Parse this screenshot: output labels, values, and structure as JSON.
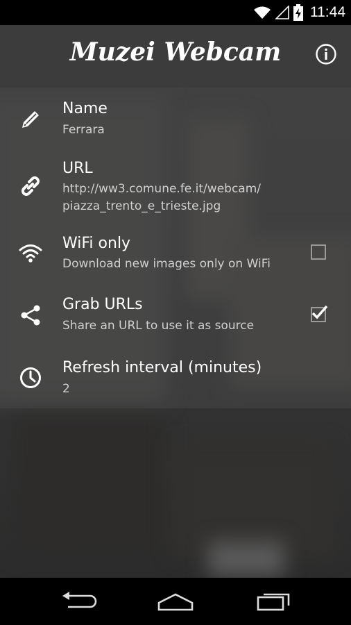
{
  "status_bar": {
    "time": "11:44",
    "icons": [
      "wifi-icon",
      "cell-signal-icon",
      "battery-charging-icon"
    ]
  },
  "app_bar": {
    "title": "Muzei Webcam",
    "info_icon": "info-icon"
  },
  "settings": [
    {
      "icon": "pencil-icon",
      "title": "Name",
      "summary": "Ferrara"
    },
    {
      "icon": "link-icon",
      "title": "URL",
      "summary": "http://ww3.comune.fe.it/webcam/\npiazza_trento_e_trieste.jpg"
    },
    {
      "icon": "wifi-icon",
      "title": "WiFi only",
      "summary": "Download new images only on WiFi",
      "checked": false
    },
    {
      "icon": "share-icon",
      "title": "Grab URLs",
      "summary": "Share an URL to use it as source",
      "checked": true
    },
    {
      "icon": "clock-icon",
      "title": "Refresh interval (minutes)",
      "summary": "2"
    }
  ],
  "nav_bar": {
    "icons": [
      "back-icon",
      "home-icon",
      "recents-icon"
    ]
  }
}
